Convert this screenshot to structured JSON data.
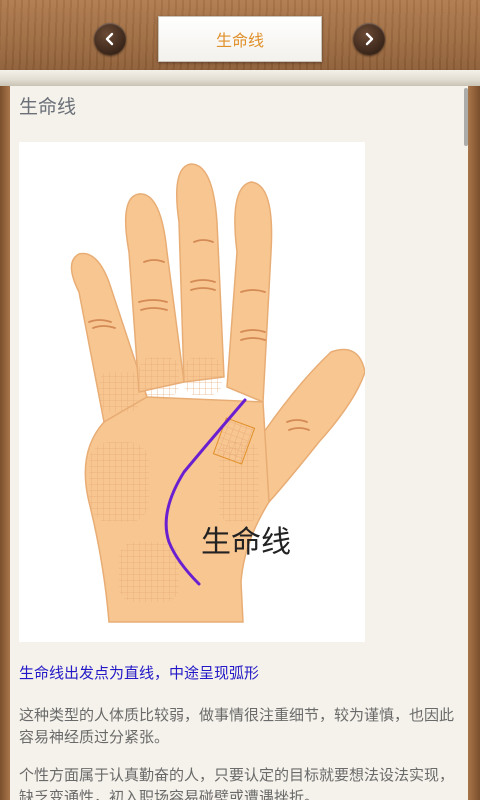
{
  "header": {
    "title": "生命线",
    "prev_icon": "chevron-left-icon",
    "next_icon": "chevron-right-icon"
  },
  "content": {
    "heading": "生命线",
    "figure_label": "生命线",
    "subtitle": "生命线出发点为直线，中途呈现弧形",
    "paragraphs": [
      "这种类型的人体质比较弱，做事情很注重细节，较为谨慎，也因此容易神经质过分紧张。",
      "个性方面属于认真勤奋的人，只要认定的目标就要想法设法实现，缺乏变通性，初入职场容易碰壁或遭遇挫折。"
    ]
  },
  "colors": {
    "title_accent": "#e0902a",
    "subtitle_blue": "#2218c8",
    "life_line": "#6a1fd0",
    "skin": "#f8c691"
  }
}
